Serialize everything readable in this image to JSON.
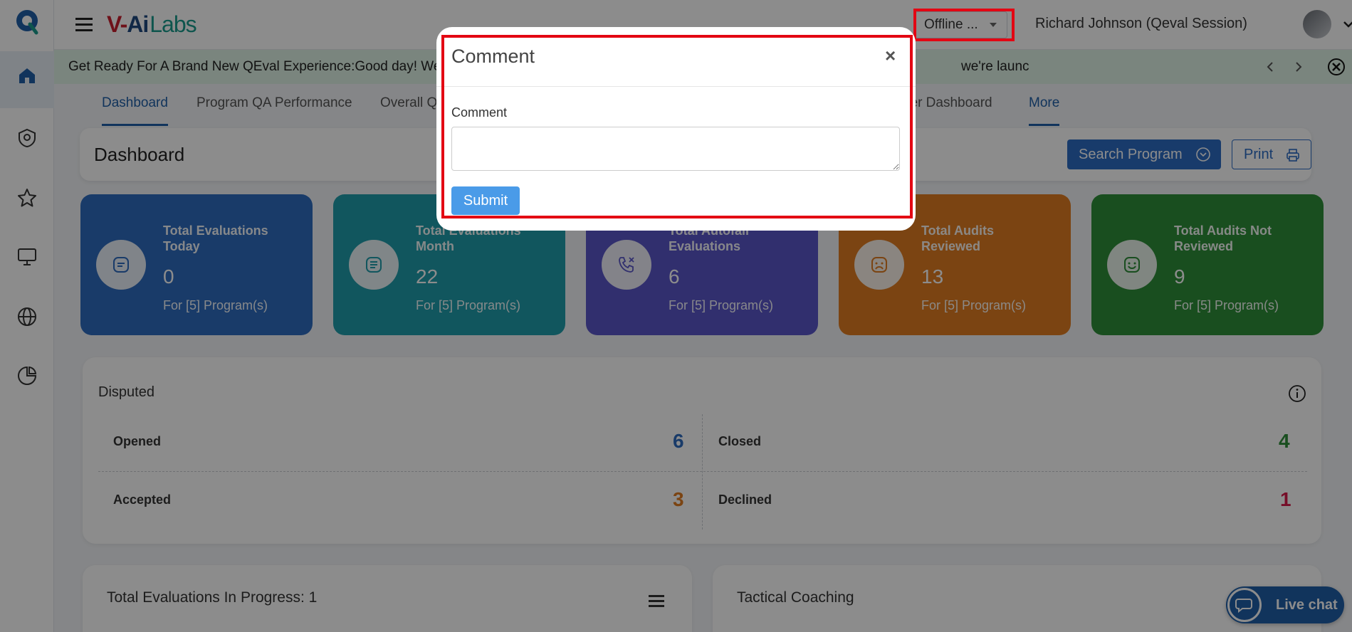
{
  "topbar": {
    "brand_v": "V-",
    "brand_ai": "Ai",
    "brand_labs": "Labs",
    "status_value": "Offline ...",
    "user_name": "Richard Johnson (Qeval Session)",
    "help_glyph": "?"
  },
  "announcement": {
    "text_left": "Get Ready For A Brand New QEval Experience:Good day! We",
    "text_right": "we're launc"
  },
  "tabs": [
    {
      "label": "Dashboard"
    },
    {
      "label": "Program QA Performance"
    },
    {
      "label": "Overall Q"
    },
    {
      "label": "ser Dashboard"
    },
    {
      "label": "More"
    }
  ],
  "dashboard": {
    "title": "Dashboard",
    "search_label": "Search Program",
    "print_label": "Print"
  },
  "kpis": [
    {
      "title": "Total Evaluations Today",
      "value": "0",
      "sub": "For [5] Program(s)",
      "color": "#2f6cc0"
    },
    {
      "title": "Total Evaluations Month",
      "value": "22",
      "sub": "For [5] Program(s)",
      "color": "#1f9dab"
    },
    {
      "title": "Total Autofail Evaluations",
      "value": "6",
      "sub": "For [5] Program(s)",
      "color": "#5a57c9"
    },
    {
      "title": "Total Audits Reviewed",
      "value": "13",
      "sub": "For [5] Program(s)",
      "color": "#e07d22"
    },
    {
      "title": "Total Audits Not Reviewed",
      "value": "9",
      "sub": "For [5] Program(s)",
      "color": "#2f8f3a"
    }
  ],
  "disputed": {
    "title": "Disputed",
    "opened_label": "Opened",
    "opened_value": "6",
    "closed_label": "Closed",
    "closed_value": "4",
    "accepted_label": "Accepted",
    "accepted_value": "3",
    "declined_label": "Declined",
    "declined_value": "1",
    "colors": {
      "opened": "#2f6cc0",
      "closed": "#2f8f3a",
      "accepted": "#e07d22",
      "declined": "#d81b4a"
    }
  },
  "bottom": {
    "in_progress_title": "Total Evaluations In Progress: 1",
    "coaching_title": "Tactical Coaching"
  },
  "livechat": {
    "label": "Live chat"
  },
  "modal": {
    "title": "Comment",
    "close_glyph": "×",
    "field_label": "Comment",
    "field_value": "",
    "submit_label": "Submit"
  }
}
